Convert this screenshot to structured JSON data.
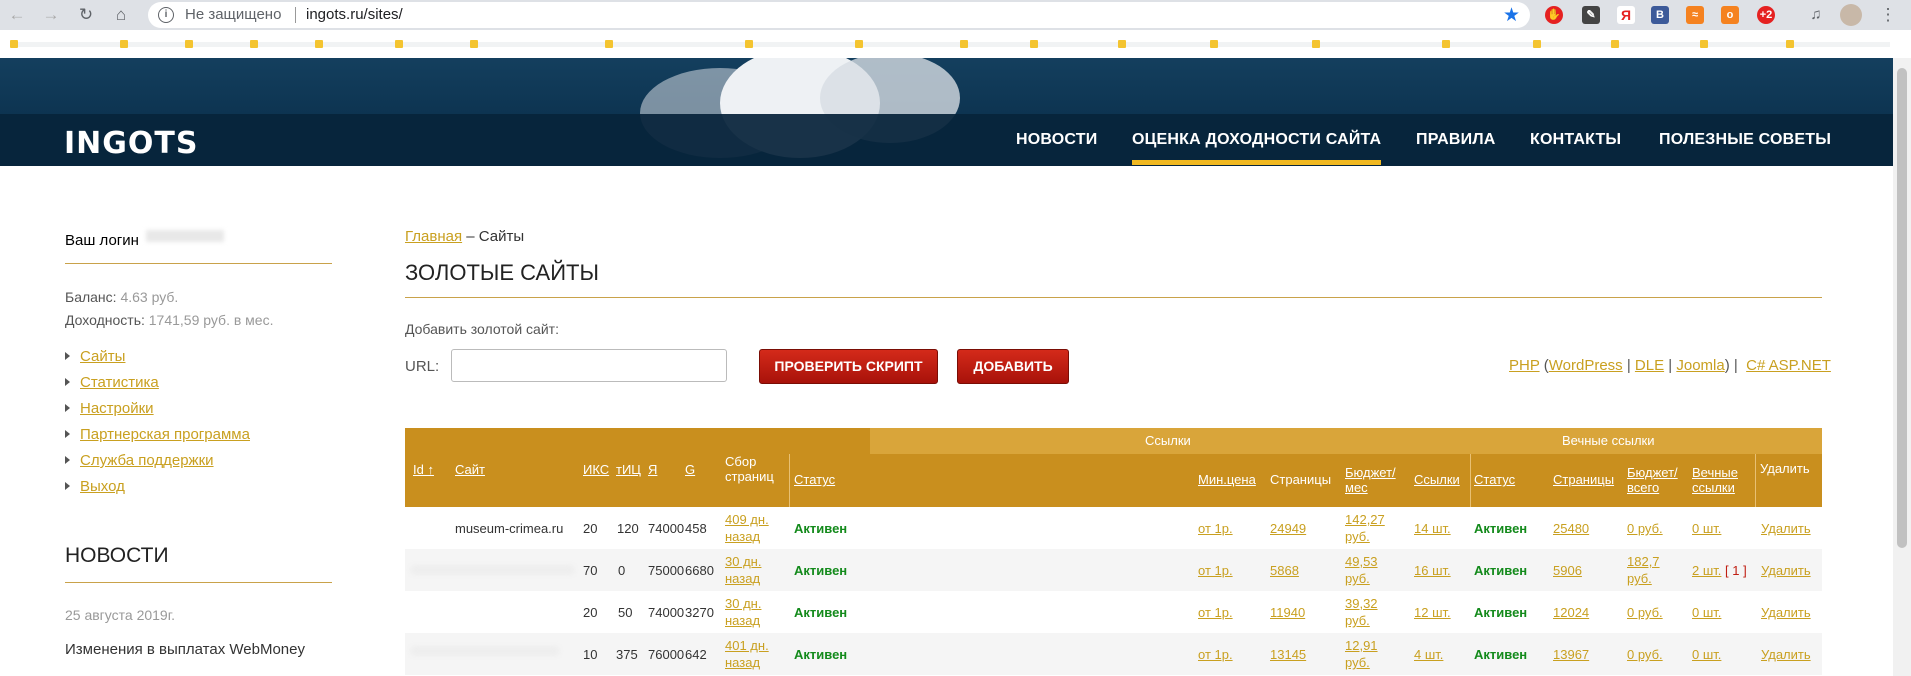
{
  "browser": {
    "insecure_label": "Не защищено",
    "url": "ingots.ru/sites/"
  },
  "site": {
    "logo": "INGOTS",
    "menu": [
      "НОВОСТИ",
      "ОЦЕНКА ДОХОДНОСТИ САЙТА",
      "ПРАВИЛА",
      "КОНТАКТЫ",
      "ПОЛЕЗНЫЕ СОВЕТЫ"
    ]
  },
  "sidebar": {
    "login_label": "Ваш логин",
    "balance_label": "Баланс:",
    "balance_value": "4.63 руб.",
    "income_label": "Доходность:",
    "income_value": "1741,59 руб. в мес.",
    "links": [
      "Сайты",
      "Статистика",
      "Настройки",
      "Партнерская программа",
      "Служба поддержки",
      "Выход"
    ],
    "news_title": "НОВОСТИ",
    "news_date": "25 августа 2019г.",
    "news_text": "Изменения в выплатах WebMoney"
  },
  "main": {
    "breadcrumb_home": "Главная",
    "breadcrumb_sep": "–",
    "breadcrumb_current": "Сайты",
    "title": "ЗОЛОТЫЕ САЙТЫ",
    "add_label": "Добавить золотой сайт:",
    "url_label": "URL:",
    "url_value": "",
    "check_button": "ПРОВЕРИТЬ СКРИПТ",
    "add_button": "ДОБАВИТЬ",
    "cms": {
      "php": "PHP",
      "open": "(",
      "wordpress": "WordPress",
      "bar1": "|",
      "dle": "DLE",
      "bar2": "|",
      "joomla": "Joomla",
      "close": ")",
      "bar3": "|",
      "aspnet": "C# ASP.NET"
    }
  },
  "table": {
    "group_links": "Ссылки",
    "group_eternal": "Вечные ссылки",
    "columns": {
      "id": "Id ↑",
      "site": "Сайт",
      "iks": "ИКС",
      "tic": "тИЦ",
      "ya": "Я",
      "g": "G",
      "collect": "Сбор страниц",
      "status": "Статус",
      "min_price": "Мин.цена",
      "pages": "Страницы",
      "budget": "Бюджет/ мес",
      "links": "Ссылки",
      "e_status": "Статус",
      "e_pages": "Страницы",
      "e_budget": "Бюджет/ всего",
      "e_links": "Вечные ссылки",
      "delete": "Удалить"
    },
    "rows": [
      {
        "site": "museum-crimea.ru",
        "iks": "20",
        "tic": "120",
        "ya": "74000",
        "g": "458",
        "collect": "409 дн. назад",
        "status": "Активен",
        "min_price": "от 1р.",
        "pages": "24949",
        "budget": "142,27 руб.",
        "links": "14 шт.",
        "e_status": "Активен",
        "e_pages": "25480",
        "e_budget": "0 руб.",
        "e_links": "0 шт.",
        "e_extra": "",
        "delete": "Удалить"
      },
      {
        "site": "",
        "iks": "70",
        "tic": "0",
        "ya": "75000",
        "g": "6680",
        "collect": "30 дн. назад",
        "status": "Активен",
        "min_price": "от 1р.",
        "pages": "5868",
        "budget": "49,53 руб.",
        "links": "16 шт.",
        "e_status": "Активен",
        "e_pages": "5906",
        "e_budget": "182,7 руб.",
        "e_links": "2 шт.",
        "e_extra": "[ 1 ]",
        "delete": "Удалить"
      },
      {
        "site": "",
        "iks": "20",
        "tic": "50",
        "ya": "74000",
        "g": "3270",
        "collect": "30 дн. назад",
        "status": "Активен",
        "min_price": "от 1р.",
        "pages": "11940",
        "budget": "39,32 руб.",
        "links": "12 шт.",
        "e_status": "Активен",
        "e_pages": "12024",
        "e_budget": "0 руб.",
        "e_links": "0 шт.",
        "e_extra": "",
        "delete": "Удалить"
      },
      {
        "site": "",
        "iks": "10",
        "tic": "375",
        "ya": "76000",
        "g": "642",
        "collect": "401 дн. назад",
        "status": "Активен",
        "min_price": "от 1р.",
        "pages": "13145",
        "budget": "12,91 руб.",
        "links": "4 шт.",
        "e_status": "Активен",
        "e_pages": "13967",
        "e_budget": "0 руб.",
        "e_links": "0 шт.",
        "e_extra": "",
        "delete": "Удалить"
      }
    ]
  },
  "colors": {
    "accent_gold": "#c9a020",
    "header_navy": "#0b3654",
    "table_header": "#c98f1e",
    "button_red": "#c01e12",
    "status_green": "#138a1b"
  }
}
